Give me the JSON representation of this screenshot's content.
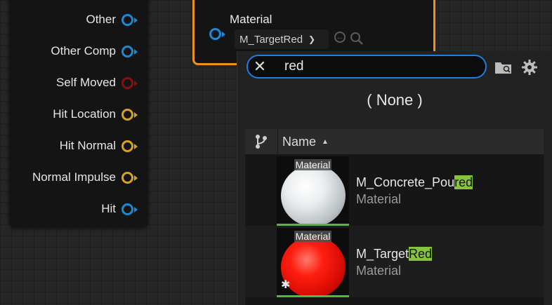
{
  "left_node": {
    "pins": [
      {
        "label": "Other",
        "color": "blue"
      },
      {
        "label": "Other Comp",
        "color": "blue"
      },
      {
        "label": "Self Moved",
        "color": "red"
      },
      {
        "label": "Hit Location",
        "color": "yellow"
      },
      {
        "label": "Hit Normal",
        "color": "yellow"
      },
      {
        "label": "Normal Impulse",
        "color": "yellow"
      },
      {
        "label": "Hit",
        "color": "blue"
      }
    ]
  },
  "material_node": {
    "title": "Material",
    "selected": "M_TargetRed"
  },
  "picker": {
    "search_value": "red",
    "none_label": "( None )",
    "column_name": "Name",
    "items": [
      {
        "name_prefix": "M_Concrete_Pou",
        "name_match": "red",
        "type": "Material",
        "thumb_label": "Material"
      },
      {
        "name_prefix": "M_Target",
        "name_match": "Red",
        "type": "Material",
        "thumb_label": "Material"
      }
    ]
  },
  "colors": {
    "accent": "#1f7de0",
    "node_border": "#f0901c",
    "highlight": "#86c43c"
  }
}
